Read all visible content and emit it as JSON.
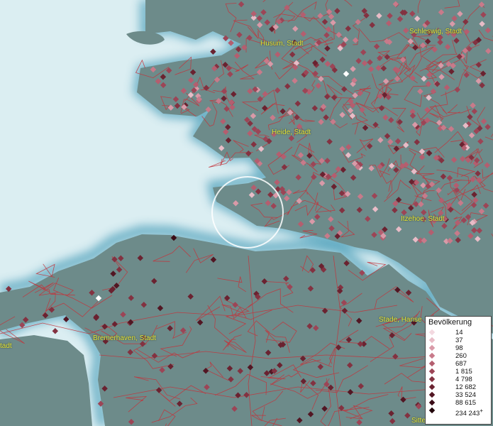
{
  "map": {
    "colors": {
      "sea": "#dbeef2",
      "shore_glow": "#5aa7bf",
      "land": "#6d8b8a",
      "borders": "#c4323a",
      "label": "#e8e83a"
    },
    "place_labels": [
      {
        "id": "husum",
        "text": "Husum, Stadt"
      },
      {
        "id": "schleswig",
        "text": "Schleswig, Stadt"
      },
      {
        "id": "heide",
        "text": "Heide, Stadt"
      },
      {
        "id": "itzehoe",
        "text": "Itzehoe, Stadt"
      },
      {
        "id": "stade",
        "text": "Stade, Hanse"
      },
      {
        "id": "bremerhaven",
        "text": "Bremerhaven, Stadt"
      },
      {
        "id": "left-edge",
        "text": "tadt"
      },
      {
        "id": "sitte",
        "text": "Sitte"
      }
    ]
  },
  "legend": {
    "title": "Bevölkerung",
    "classes": [
      {
        "label": "14",
        "color": "#f3d9e0"
      },
      {
        "label": "37",
        "color": "#e8bcc7"
      },
      {
        "label": "98",
        "color": "#d99aa8"
      },
      {
        "label": "260",
        "color": "#c87a8a"
      },
      {
        "label": "687",
        "color": "#b45e6f"
      },
      {
        "label": "1 815",
        "color": "#9c4556"
      },
      {
        "label": "4 798",
        "color": "#833241"
      },
      {
        "label": "12 682",
        "color": "#6a2230"
      },
      {
        "label": "33 524",
        "color": "#521623"
      },
      {
        "label": "88 615",
        "color": "#3a0c17"
      },
      {
        "label": "234 243",
        "color": "#22050b"
      }
    ],
    "overflow_mark": "+"
  }
}
